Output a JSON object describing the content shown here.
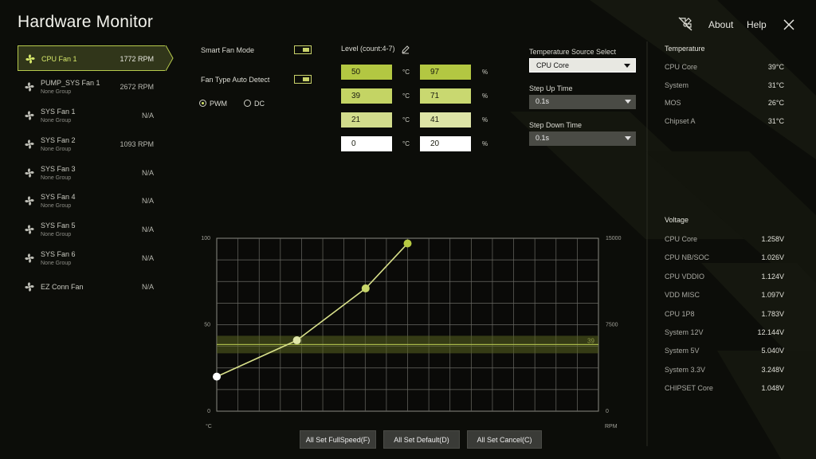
{
  "app": {
    "title": "Hardware Monitor"
  },
  "header": {
    "about": "About",
    "help": "Help",
    "close_icon": "close-icon",
    "fan_off_icon": "fan-off-icon"
  },
  "fans": [
    {
      "name": "CPU Fan 1",
      "group": "",
      "rpm": "1772 RPM",
      "selected": true
    },
    {
      "name": "PUMP_SYS Fan 1",
      "group": "None Group",
      "rpm": "2672 RPM",
      "selected": false
    },
    {
      "name": "SYS Fan 1",
      "group": "None Group",
      "rpm": "N/A",
      "selected": false
    },
    {
      "name": "SYS Fan 2",
      "group": "None Group",
      "rpm": "1093 RPM",
      "selected": false
    },
    {
      "name": "SYS Fan 3",
      "group": "None Group",
      "rpm": "N/A",
      "selected": false
    },
    {
      "name": "SYS Fan 4",
      "group": "None Group",
      "rpm": "N/A",
      "selected": false
    },
    {
      "name": "SYS Fan 5",
      "group": "None Group",
      "rpm": "N/A",
      "selected": false
    },
    {
      "name": "SYS Fan 6",
      "group": "None Group",
      "rpm": "N/A",
      "selected": false
    },
    {
      "name": "EZ Conn Fan",
      "group": "",
      "rpm": "N/A",
      "selected": false
    }
  ],
  "controls": {
    "smart_fan_mode": "Smart Fan Mode",
    "smart_fan_on": true,
    "fan_type_auto": "Fan Type Auto Detect",
    "fan_type_auto_on": true,
    "mode_pwm": "PWM",
    "mode_dc": "DC",
    "selected_mode": "PWM"
  },
  "levels": {
    "label": "Level (count:4-7)",
    "temp_unit": "°C",
    "speed_unit": "%",
    "rows": [
      {
        "temp": "50",
        "speed": "97"
      },
      {
        "temp": "39",
        "speed": "71"
      },
      {
        "temp": "21",
        "speed": "41"
      },
      {
        "temp": "0",
        "speed": "20"
      }
    ]
  },
  "temp_source": {
    "label": "Temperature Source Select",
    "value": "CPU Core",
    "step_up_label": "Step Up Time",
    "step_up_value": "0.1s",
    "step_down_label": "Step Down Time",
    "step_down_value": "0.1s"
  },
  "temperature": {
    "title": "Temperature",
    "items": [
      {
        "name": "CPU Core",
        "value": "39°C"
      },
      {
        "name": "System",
        "value": "31°C"
      },
      {
        "name": "MOS",
        "value": "26°C"
      },
      {
        "name": "Chipset A",
        "value": "31°C"
      }
    ]
  },
  "voltage": {
    "title": "Voltage",
    "items": [
      {
        "name": "CPU Core",
        "value": "1.258V"
      },
      {
        "name": "CPU NB/SOC",
        "value": "1.026V"
      },
      {
        "name": "CPU VDDIO",
        "value": "1.124V"
      },
      {
        "name": "VDD MISC",
        "value": "1.097V"
      },
      {
        "name": "CPU 1P8",
        "value": "1.783V"
      },
      {
        "name": "System 12V",
        "value": "12.144V"
      },
      {
        "name": "System 5V",
        "value": "5.040V"
      },
      {
        "name": "System 3.3V",
        "value": "3.248V"
      },
      {
        "name": "CHIPSET Core",
        "value": "1.048V"
      }
    ]
  },
  "chart": {
    "left_ticks": [
      "100",
      "50",
      "0"
    ],
    "right_ticks": [
      "15000",
      "7500",
      "0"
    ],
    "left_unit": "°C",
    "right_unit": "RPM",
    "current_temp": "39",
    "current_rpm": "1772"
  },
  "chart_data": {
    "type": "line",
    "x_range": [
      0,
      100
    ],
    "y_range": [
      0,
      100
    ],
    "y2_range": [
      0,
      15000
    ],
    "curve": {
      "x": [
        0,
        21,
        39,
        50
      ],
      "y": [
        20,
        41,
        71,
        97
      ]
    },
    "current_temp": 39,
    "current_rpm": 1772
  },
  "buttons": {
    "full_speed": "All Set FullSpeed(F)",
    "default": "All Set Default(D)",
    "cancel": "All Set Cancel(C)"
  },
  "colors": {
    "accent": "#c9d94f",
    "background": "#0c0d09"
  }
}
